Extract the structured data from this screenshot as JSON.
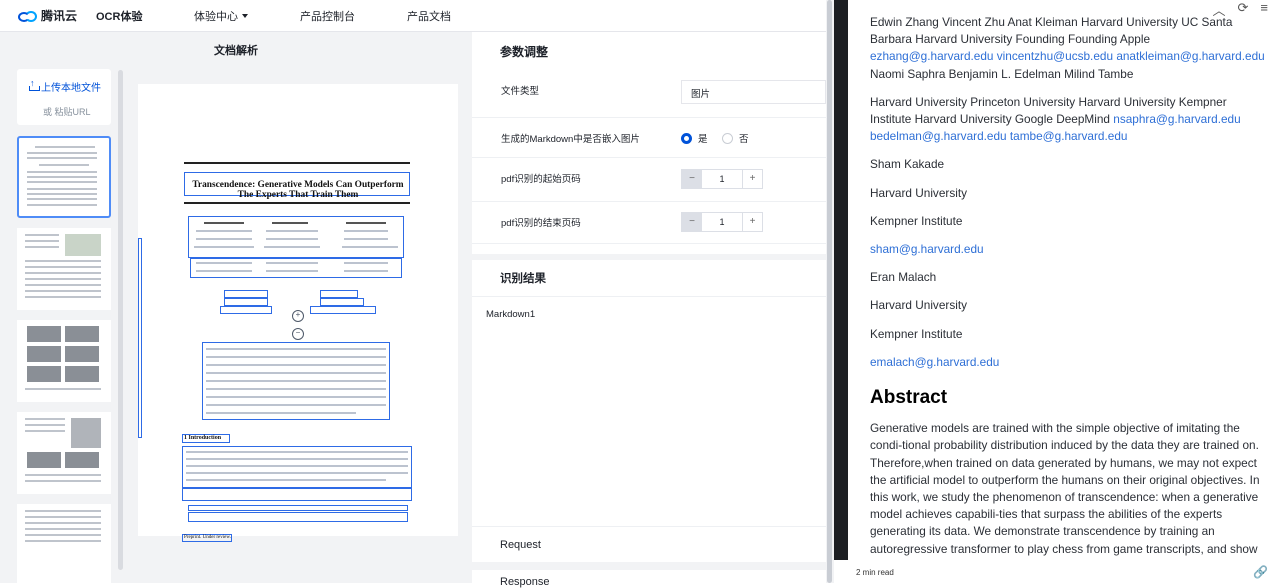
{
  "header": {
    "logo_text": "腾讯云",
    "product": "OCR体验",
    "nav": [
      "体验中心",
      "产品控制台",
      "产品文档"
    ]
  },
  "left": {
    "title": "文档解析",
    "upload_label": "上传本地文件",
    "paste_label": "或 粘贴URL"
  },
  "doc_preview": {
    "title": "Transcendence: Generative Models Can Outperform The Experts That Train Them",
    "section": "1    Introduction",
    "footer": "Preprint. Under review."
  },
  "params": {
    "title": "参数调整",
    "file_type_label": "文件类型",
    "file_type_value": "图片",
    "embed_label": "生成的Markdown中是否嵌入图片",
    "embed_yes": "是",
    "embed_no": "否",
    "start_label": "pdf识别的起始页码",
    "start_value": "1",
    "end_label": "pdf识别的结束页码",
    "end_value": "1"
  },
  "results": {
    "title": "识别结果",
    "markdown_tab": "Markdown1",
    "request_label": "Request",
    "response_label": "Response"
  },
  "markdown": {
    "p1_text": "Edwin Zhang Vincent Zhu Anat Kleiman Harvard University UC Santa Barbara Harvard University Founding Founding Apple",
    "p1_link1": "ezhang@g.harvard.edu",
    "p1_link2": "vincentzhu@ucsb.edu",
    "p1_link3": "anatkleiman@g.harvard.edu",
    "p1_tail": "Naomi Saphra Benjamin L. Edelman Milind Tambe",
    "p2_text": "Harvard University Princeton University Harvard University Kempner Institute Harvard University Google DeepMind",
    "p2_link1": "nsaphra@g.harvard.edu",
    "p2_link2": "bedelman@g.harvard.edu",
    "p2_link3": "tambe@g.harvard.edu",
    "l1": "Sham Kakade",
    "l2": "Harvard University",
    "l3": "Kempner Institute",
    "l4": "sham@g.harvard.edu",
    "l5": "Eran Malach",
    "l6": "Harvard University",
    "l7": "Kempner Institute",
    "l8": "emalach@g.harvard.edu",
    "abstract_heading": "Abstract",
    "abstract_text": "Generative models are trained with the simple objective of imitating the condi-tional probability distribution induced by the data they are trained on. Therefore,when trained on data generated by humans, we may not expect the artificial model to outperform the humans on their original objectives. In this work, we study the phenomenon of transcendence: when a generative model achieves capabili-ties that surpass the abilities of the experts generating its data. We demonstrate transcendence by training an autoregressive transformer to play chess from game transcripts, and show that the trained model can sometimes",
    "read_time": "2 min read"
  }
}
